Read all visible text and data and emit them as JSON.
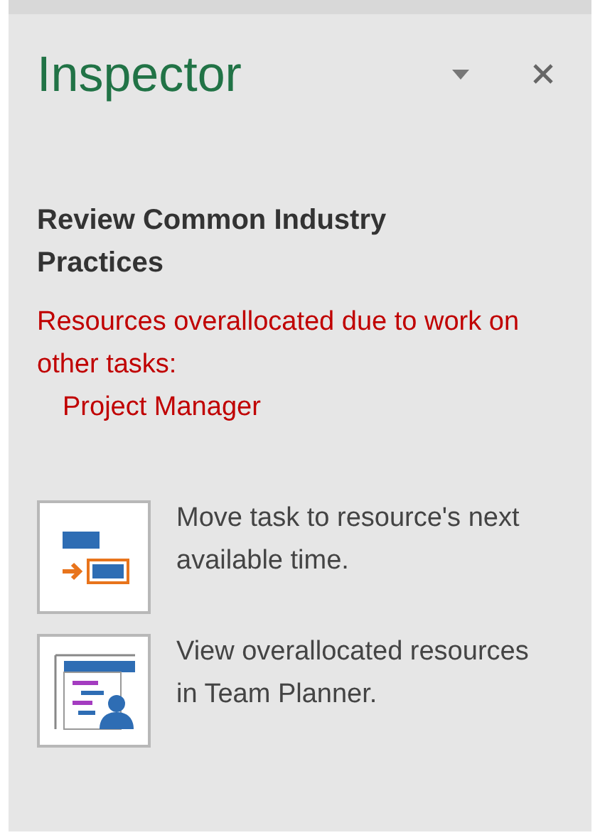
{
  "panel": {
    "title": "Inspector"
  },
  "section": {
    "heading": "Review Common Industry Practices",
    "warning": "Resources overallocated due to work on other tasks:",
    "resource": "Project Manager"
  },
  "actions": [
    {
      "kind": "move",
      "label": "Move task to resource's next available time."
    },
    {
      "kind": "planner",
      "label": "View overallocated resources in Team Planner."
    }
  ]
}
